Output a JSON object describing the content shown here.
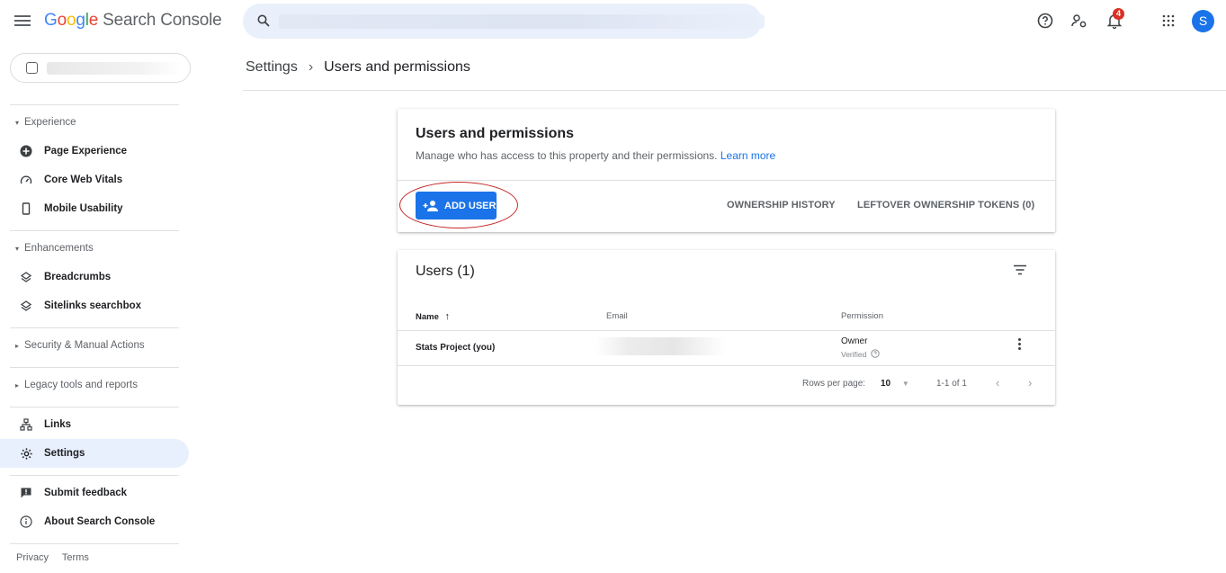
{
  "app": {
    "brand_letters": [
      "G",
      "o",
      "o",
      "g",
      "l",
      "e"
    ],
    "brand_rest": "Search Console",
    "notification_count": "4",
    "avatar_initial": "S"
  },
  "sidebar": {
    "sections": {
      "experience": "Experience",
      "enhancements": "Enhancements",
      "security": "Security & Manual Actions",
      "legacy": "Legacy tools and reports"
    },
    "items": {
      "page_experience": "Page Experience",
      "core_web_vitals": "Core Web Vitals",
      "mobile_usability": "Mobile Usability",
      "breadcrumbs": "Breadcrumbs",
      "sitelinks_searchbox": "Sitelinks searchbox",
      "links": "Links",
      "settings": "Settings",
      "submit_feedback": "Submit feedback",
      "about": "About Search Console"
    },
    "footer": {
      "privacy": "Privacy",
      "terms": "Terms"
    }
  },
  "breadcrumb": {
    "parent": "Settings",
    "separator": "›",
    "current": "Users and permissions"
  },
  "permissions_card": {
    "title": "Users and permissions",
    "description": "Manage who has access to this property and their permissions.",
    "learn_more": "Learn more",
    "add_user": "ADD USER",
    "ownership_history": "OWNERSHIP HISTORY",
    "leftover_tokens": "LEFTOVER OWNERSHIP TOKENS (0)"
  },
  "users_card": {
    "title": "Users (1)",
    "columns": {
      "name": "Name",
      "email": "Email",
      "permission": "Permission"
    },
    "sort_arrow": "↑",
    "rows": [
      {
        "name": "Stats Project (you)",
        "permission": "Owner",
        "status": "Verified"
      }
    ],
    "rows_per_page_label": "Rows per page:",
    "rows_per_page_value": "10",
    "range": "1-1 of 1"
  },
  "colors": {
    "accent": "#1a73e8",
    "active_nav": "#e8f0fe",
    "badge": "#d93025",
    "highlight": "#c62828"
  }
}
